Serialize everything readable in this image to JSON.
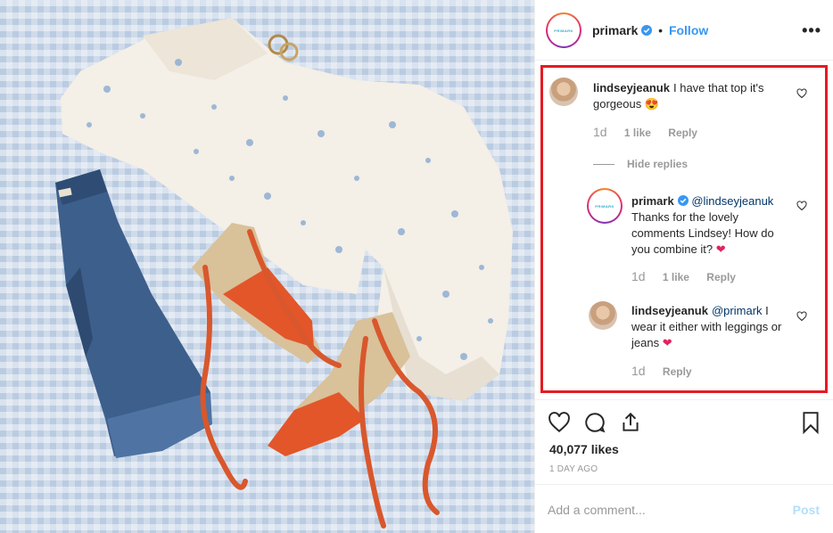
{
  "post": {
    "username": "primark",
    "follow_label": "Follow",
    "brand_logo_text": "PRIMARK",
    "more_icon": "more-horizontal-icon",
    "likes": "40,077 likes",
    "time_ago": "1 DAY AGO"
  },
  "comments": [
    {
      "username": "lindseyjeanuk",
      "text": "I have that top it's gorgeous",
      "emoji": "heart-eyes-emoji",
      "age": "1d",
      "likes": "1 like",
      "reply_label": "Reply"
    }
  ],
  "hide_replies_label": "Hide replies",
  "replies": [
    {
      "username": "primark",
      "mention": "@lindseyjeanuk",
      "text": "Thanks for the lovely comments Lindsey! How do you combine it?",
      "emoji": "red-heart-emoji",
      "age": "1d",
      "likes": "1 like",
      "reply_label": "Reply"
    },
    {
      "username": "lindseyjeanuk",
      "mention": "@primark",
      "text": "I wear it either with leggings or jeans",
      "emoji": "red-heart-emoji",
      "age": "1d",
      "reply_label": "Reply"
    }
  ],
  "comment_box": {
    "placeholder": "Add a comment...",
    "post_label": "Post"
  },
  "colors": {
    "link": "#3897f0",
    "highlight_border": "#e31b23",
    "muted": "#999999"
  }
}
